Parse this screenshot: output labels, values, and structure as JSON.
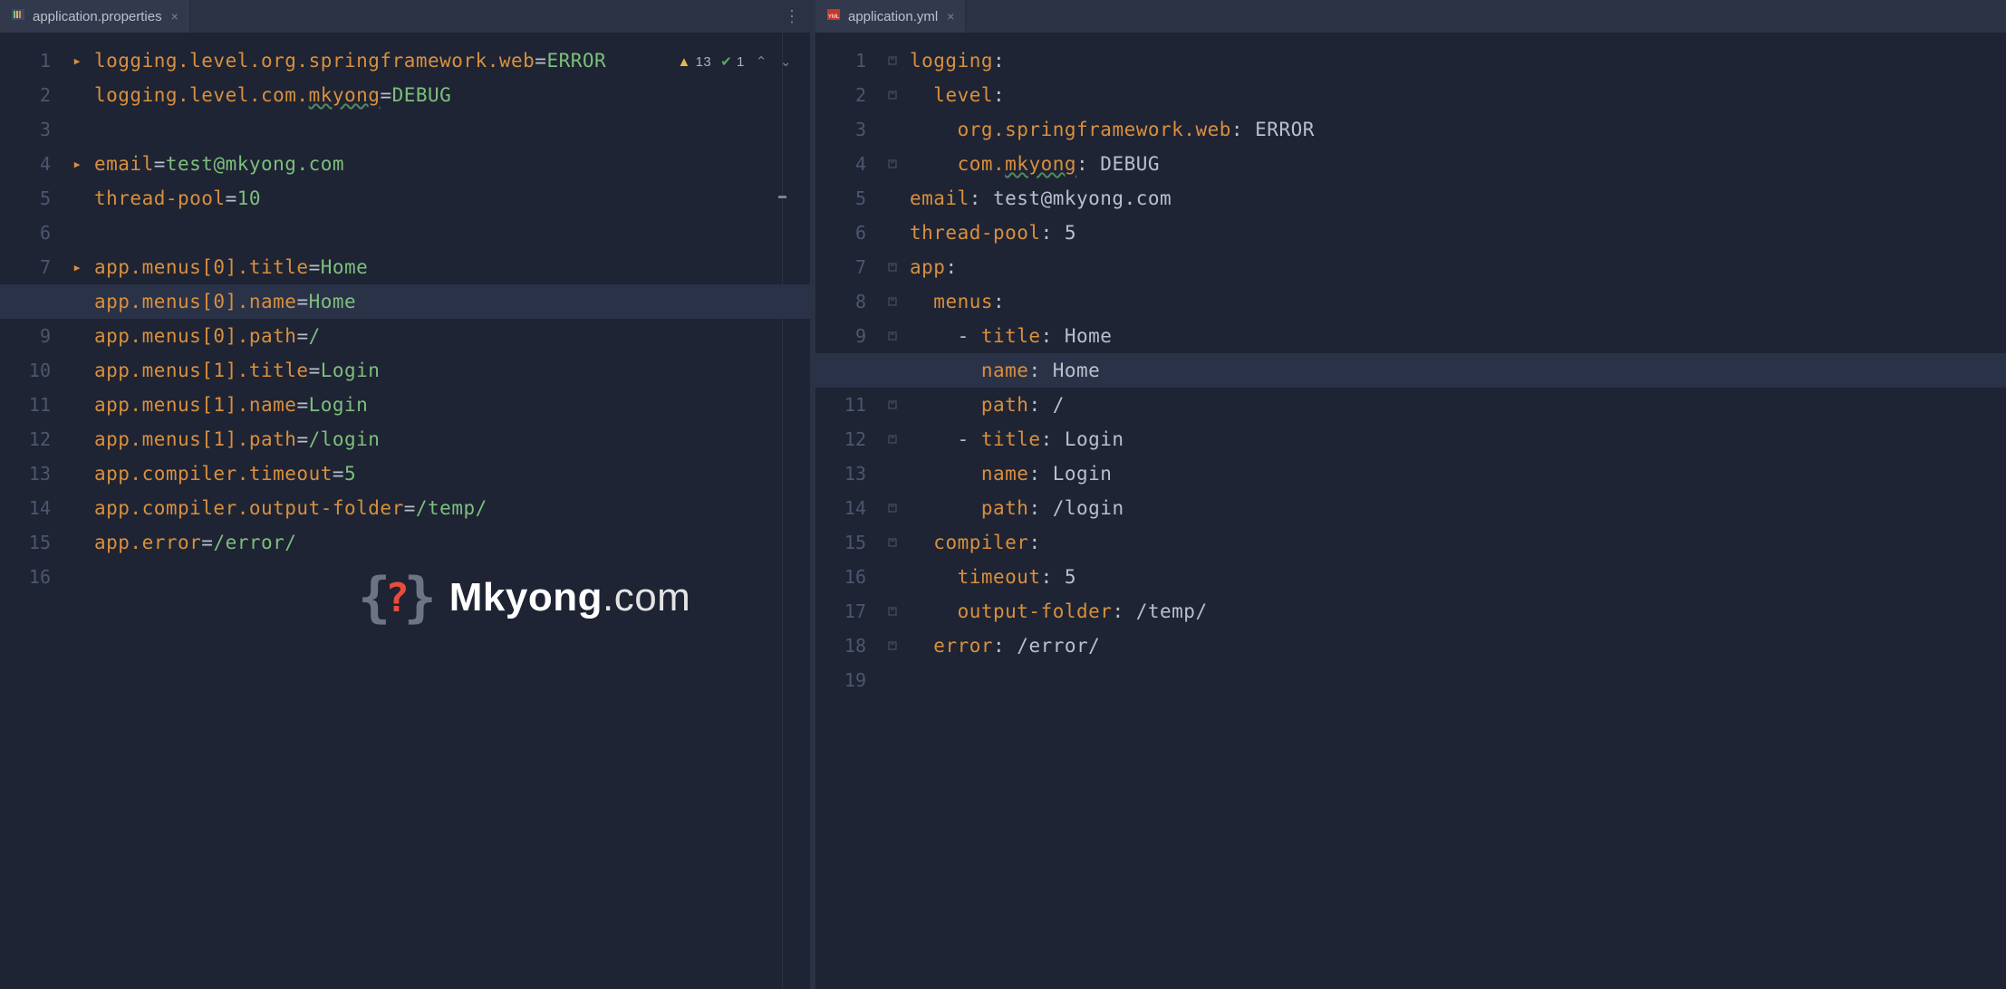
{
  "left": {
    "tab": {
      "title": "application.properties"
    },
    "inspections": {
      "warn_count": "13",
      "ok_count": "1"
    },
    "highlight_line": 8,
    "lines": [
      [
        {
          "cls": "c-key",
          "t": "logging.level.org.springframework.web"
        },
        {
          "cls": "c-plain",
          "t": "="
        },
        {
          "cls": "c-val",
          "t": "ERROR"
        }
      ],
      [
        {
          "cls": "c-key",
          "t": "logging.level.com."
        },
        {
          "cls": "c-key c-wavy",
          "t": "mkyong"
        },
        {
          "cls": "c-plain",
          "t": "="
        },
        {
          "cls": "c-val",
          "t": "DEBUG"
        }
      ],
      [],
      [
        {
          "cls": "c-key",
          "t": "email"
        },
        {
          "cls": "c-plain",
          "t": "="
        },
        {
          "cls": "c-val",
          "t": "test@mkyong.com"
        }
      ],
      [
        {
          "cls": "c-key",
          "t": "thread-pool"
        },
        {
          "cls": "c-plain",
          "t": "="
        },
        {
          "cls": "c-val",
          "t": "10"
        }
      ],
      [],
      [
        {
          "cls": "c-key",
          "t": "app.menus[0].title"
        },
        {
          "cls": "c-plain",
          "t": "="
        },
        {
          "cls": "c-val",
          "t": "Home"
        }
      ],
      [
        {
          "cls": "c-key",
          "t": "app.menus[0].name"
        },
        {
          "cls": "c-plain",
          "t": "="
        },
        {
          "cls": "c-val",
          "t": "Home"
        }
      ],
      [
        {
          "cls": "c-key",
          "t": "app.menus[0].path"
        },
        {
          "cls": "c-plain",
          "t": "="
        },
        {
          "cls": "c-val",
          "t": "/"
        }
      ],
      [
        {
          "cls": "c-key",
          "t": "app.menus[1].title"
        },
        {
          "cls": "c-plain",
          "t": "="
        },
        {
          "cls": "c-val",
          "t": "Login"
        }
      ],
      [
        {
          "cls": "c-key",
          "t": "app.menus[1].name"
        },
        {
          "cls": "c-plain",
          "t": "="
        },
        {
          "cls": "c-val",
          "t": "Login"
        }
      ],
      [
        {
          "cls": "c-key",
          "t": "app.menus[1].path"
        },
        {
          "cls": "c-plain",
          "t": "="
        },
        {
          "cls": "c-val",
          "t": "/login"
        }
      ],
      [
        {
          "cls": "c-key",
          "t": "app.compiler.timeout"
        },
        {
          "cls": "c-plain",
          "t": "="
        },
        {
          "cls": "c-val",
          "t": "5"
        }
      ],
      [
        {
          "cls": "c-key",
          "t": "app.compiler.output-folder"
        },
        {
          "cls": "c-plain",
          "t": "="
        },
        {
          "cls": "c-val",
          "t": "/temp/"
        }
      ],
      [
        {
          "cls": "c-key",
          "t": "app.error"
        },
        {
          "cls": "c-plain",
          "t": "="
        },
        {
          "cls": "c-val",
          "t": "/error/"
        }
      ],
      []
    ],
    "fold_triangles": [
      1,
      4,
      7
    ]
  },
  "right": {
    "tab": {
      "title": "application.yml"
    },
    "highlight_line": 10,
    "lines": [
      [
        {
          "cls": "c-key",
          "t": "logging"
        },
        {
          "cls": "c-plain",
          "t": ":"
        }
      ],
      [
        {
          "cls": "c-plain",
          "t": "  "
        },
        {
          "cls": "c-key",
          "t": "level"
        },
        {
          "cls": "c-plain",
          "t": ":"
        }
      ],
      [
        {
          "cls": "c-plain",
          "t": "    "
        },
        {
          "cls": "c-key",
          "t": "org.springframework.web"
        },
        {
          "cls": "c-plain",
          "t": ": ERROR"
        }
      ],
      [
        {
          "cls": "c-plain",
          "t": "    "
        },
        {
          "cls": "c-key",
          "t": "com."
        },
        {
          "cls": "c-key c-wavy",
          "t": "mkyong"
        },
        {
          "cls": "c-plain",
          "t": ": DEBUG"
        }
      ],
      [
        {
          "cls": "c-key",
          "t": "email"
        },
        {
          "cls": "c-plain",
          "t": ": test@mkyong.com"
        }
      ],
      [
        {
          "cls": "c-key",
          "t": "thread-pool"
        },
        {
          "cls": "c-plain",
          "t": ": 5"
        }
      ],
      [
        {
          "cls": "c-key",
          "t": "app"
        },
        {
          "cls": "c-plain",
          "t": ":"
        }
      ],
      [
        {
          "cls": "c-plain",
          "t": "  "
        },
        {
          "cls": "c-key",
          "t": "menus"
        },
        {
          "cls": "c-plain",
          "t": ":"
        }
      ],
      [
        {
          "cls": "c-plain",
          "t": "    - "
        },
        {
          "cls": "c-key",
          "t": "title"
        },
        {
          "cls": "c-plain",
          "t": ": Home"
        }
      ],
      [
        {
          "cls": "c-plain",
          "t": "      "
        },
        {
          "cls": "c-key",
          "t": "name"
        },
        {
          "cls": "c-plain",
          "t": ": Home"
        }
      ],
      [
        {
          "cls": "c-plain",
          "t": "      "
        },
        {
          "cls": "c-key",
          "t": "path"
        },
        {
          "cls": "c-plain",
          "t": ": /"
        }
      ],
      [
        {
          "cls": "c-plain",
          "t": "    - "
        },
        {
          "cls": "c-key",
          "t": "title"
        },
        {
          "cls": "c-plain",
          "t": ": Login"
        }
      ],
      [
        {
          "cls": "c-plain",
          "t": "      "
        },
        {
          "cls": "c-key",
          "t": "name"
        },
        {
          "cls": "c-plain",
          "t": ": Login"
        }
      ],
      [
        {
          "cls": "c-plain",
          "t": "      "
        },
        {
          "cls": "c-key",
          "t": "path"
        },
        {
          "cls": "c-plain",
          "t": ": /login"
        }
      ],
      [
        {
          "cls": "c-plain",
          "t": "  "
        },
        {
          "cls": "c-key",
          "t": "compiler"
        },
        {
          "cls": "c-plain",
          "t": ":"
        }
      ],
      [
        {
          "cls": "c-plain",
          "t": "    "
        },
        {
          "cls": "c-key",
          "t": "timeout"
        },
        {
          "cls": "c-plain",
          "t": ": 5"
        }
      ],
      [
        {
          "cls": "c-plain",
          "t": "    "
        },
        {
          "cls": "c-key",
          "t": "output-folder"
        },
        {
          "cls": "c-plain",
          "t": ": /temp/"
        }
      ],
      [
        {
          "cls": "c-plain",
          "t": "  "
        },
        {
          "cls": "c-key",
          "t": "error"
        },
        {
          "cls": "c-plain",
          "t": ": /error/"
        }
      ],
      []
    ],
    "fold_markers": [
      1,
      2,
      4,
      7,
      8,
      9,
      11,
      12,
      14,
      15,
      17,
      18
    ]
  },
  "watermark": {
    "brand": "Mkyong",
    "suffix": ".com"
  }
}
